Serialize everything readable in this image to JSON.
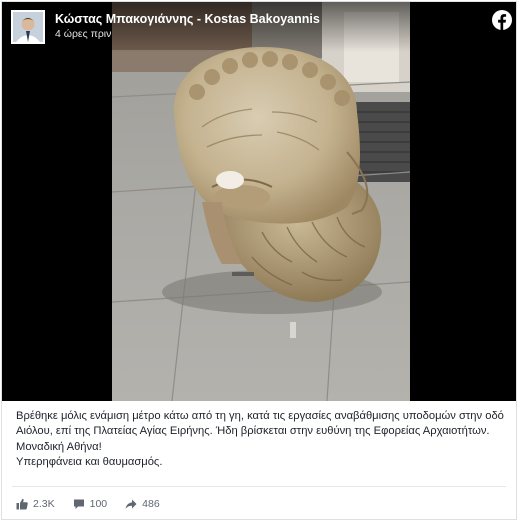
{
  "post": {
    "author": "Κώστας Μπακογιάννης - Kostas Bakoyannis",
    "time": "4 ώρες πριν",
    "caption": {
      "line1": "Βρέθηκε μόλις ενάμιση μέτρο κάτω από τη γη, κατά τις εργασίες αναβάθμισης υποδομών στην οδό",
      "line2": "Αιόλου, επί της Πλατείας Αγίας Ειρήνης. Ήδη βρίσκεται στην ευθύνη της Εφορείας Αρχαιοτήτων.",
      "line3": "Μοναδική Αθήνα!",
      "line4": "Υπερηφάνεια και θαυμασμός."
    }
  },
  "stats": {
    "likes": "2.3K",
    "comments": "100",
    "shares": "486"
  },
  "icons": {
    "brand": "facebook-icon",
    "like": "thumbs-up-icon",
    "comment": "comment-icon",
    "share": "share-arrow-icon"
  },
  "colors": {
    "facebook_brand": "#ffffff",
    "text": "#1d2129",
    "muted": "#606770",
    "media_background": "#000000"
  }
}
